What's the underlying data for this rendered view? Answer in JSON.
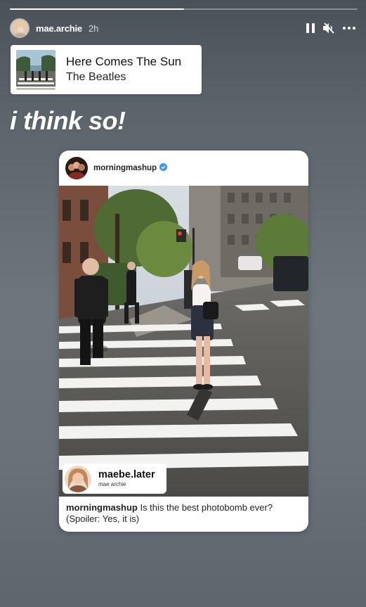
{
  "story": {
    "progress_fraction": 0.5,
    "username": "mae.archie",
    "time_ago": "2h",
    "controls": [
      "pause-icon",
      "mute-icon",
      "more-icon"
    ]
  },
  "music": {
    "song": "Here Comes The Sun",
    "artist": "The Beatles"
  },
  "sticker_text": "i think so!",
  "post": {
    "username": "morningmashup",
    "verified": true,
    "tag": {
      "username": "maebe.later",
      "subname": "mae archie"
    },
    "caption": {
      "user": "morningmashup",
      "text": " Is this the best photobomb ever? (Spoiler: Yes, it is)"
    }
  },
  "colors": {
    "background": "#6a7279",
    "verified": "#3897f0",
    "card": "#ffffff"
  }
}
